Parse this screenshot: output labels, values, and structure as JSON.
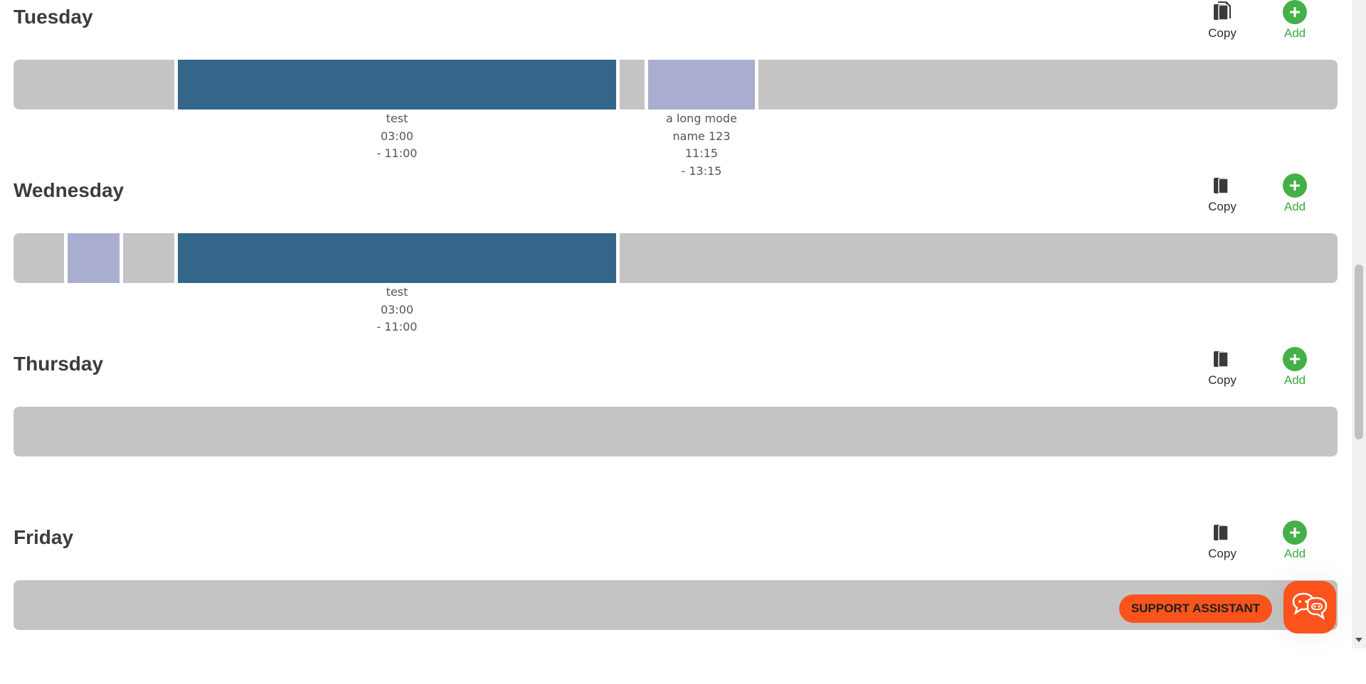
{
  "days": [
    {
      "name": "Tuesday",
      "copy_label": "Copy",
      "add_label": "Add",
      "segments": [
        {
          "label_lines": [
            "test",
            "03:00",
            "- 11:00"
          ]
        },
        {
          "label_lines": [
            "a long mode",
            "name 123",
            "11:15",
            "- 13:15"
          ]
        }
      ]
    },
    {
      "name": "Wednesday",
      "copy_label": "Copy",
      "add_label": "Add",
      "segments": [
        {
          "label_lines": [
            "test",
            "03:00",
            "- 11:00"
          ]
        }
      ]
    },
    {
      "name": "Thursday",
      "copy_label": "Copy",
      "add_label": "Add"
    },
    {
      "name": "Friday",
      "copy_label": "Copy",
      "add_label": "Add"
    }
  ],
  "support": {
    "button_label": "SUPPORT ASSISTANT",
    "chat_icon": "chat-bubbles-icon"
  },
  "icons": {
    "copy": "copy-document-icon",
    "add": "plus-circle-icon"
  },
  "colors": {
    "schedule_block": "#336688",
    "schedule_block_alt": "#a9aed0",
    "empty_track": "#c4c4c4",
    "add_green": "#44b048",
    "support_orange": "#fa541c"
  }
}
